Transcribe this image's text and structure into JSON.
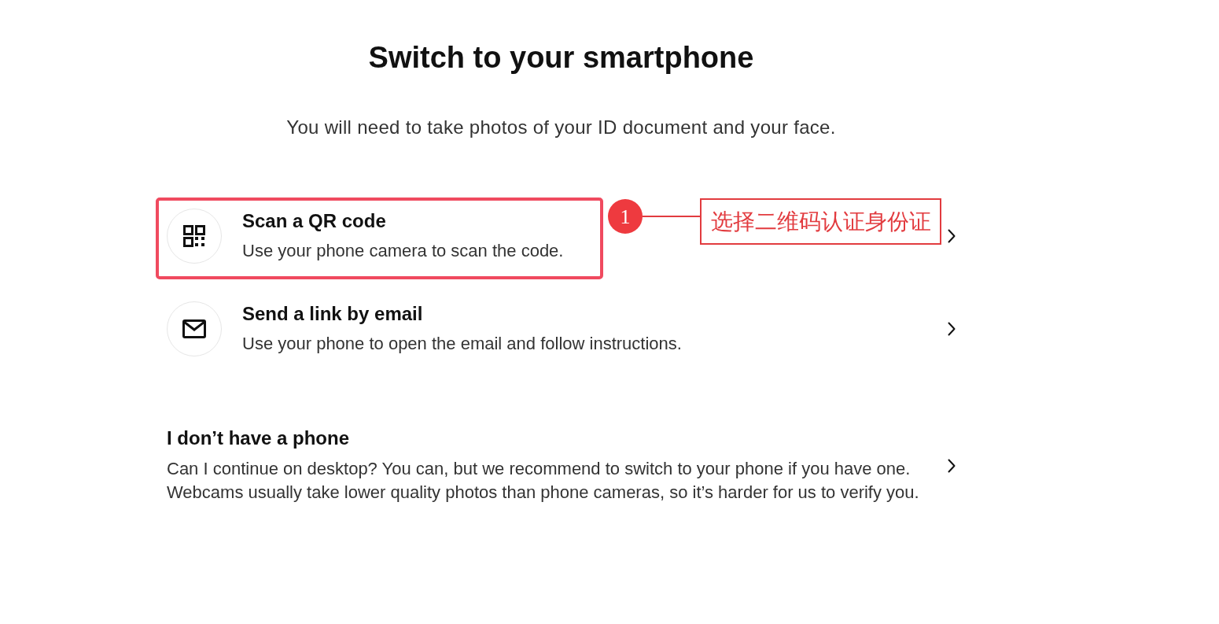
{
  "heading": "Switch to your smartphone",
  "subheading": "You will need to take photos of your ID document and your face.",
  "options": [
    {
      "kind": "qr",
      "title": "Scan a QR code",
      "description": "Use your phone camera to scan the code.",
      "highlighted": true,
      "callout": {
        "number": "1",
        "label": "选择二维码认证身份证"
      }
    },
    {
      "kind": "email",
      "title": "Send a link by email",
      "description": "Use your phone to open the email and follow instructions.",
      "highlighted": false
    }
  ],
  "no_phone": {
    "title": "I don’t have a phone",
    "lines": [
      "Can I continue on desktop? You can, but we recommend to switch to your phone if you have one.",
      "Webcams usually take lower quality photos than phone cameras, so it’s harder for us to verify you."
    ]
  }
}
